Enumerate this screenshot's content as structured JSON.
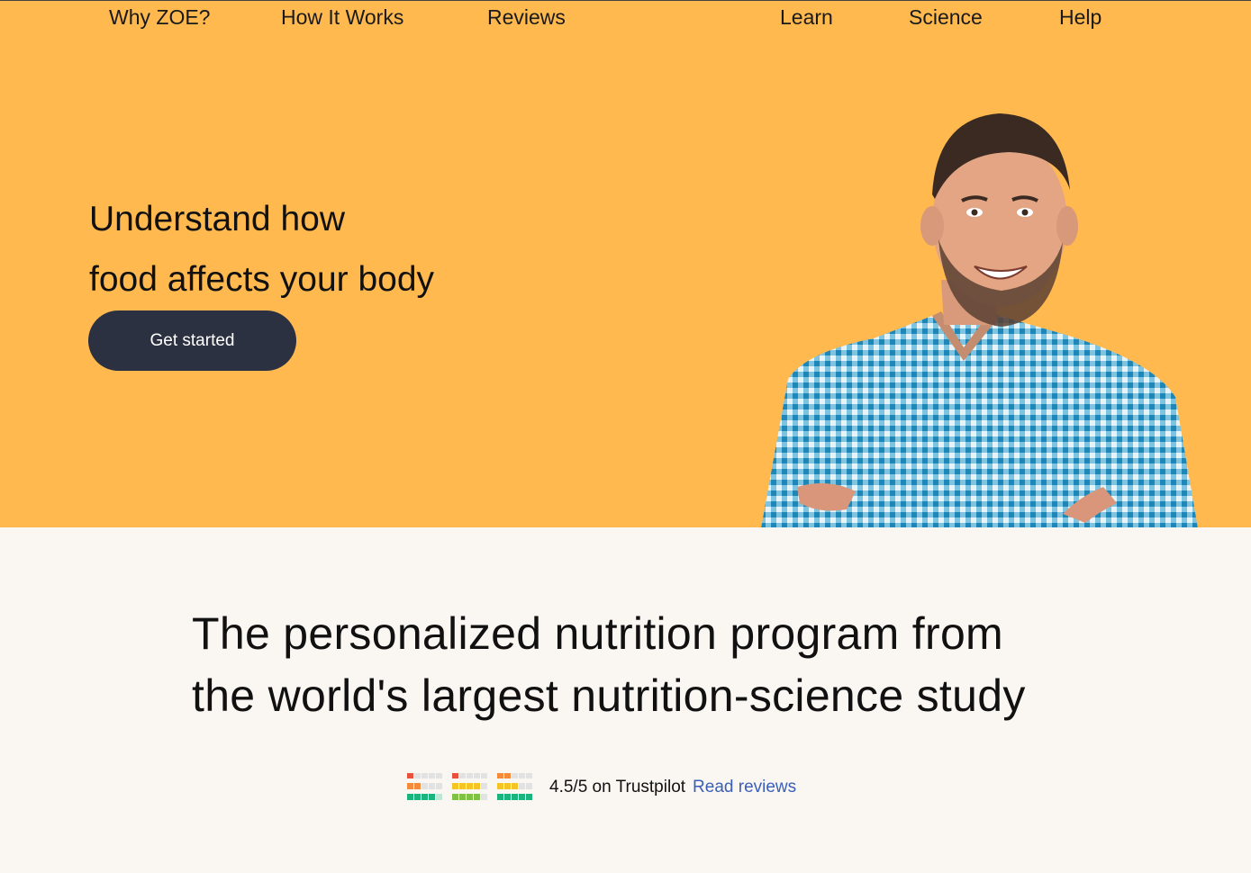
{
  "nav": {
    "items": [
      "Why ZOE?",
      "How It Works",
      "Reviews",
      "Learn",
      "Science",
      "Help"
    ]
  },
  "hero": {
    "headline_line1": "Understand how",
    "headline_line2": "food affects your body",
    "cta_label": "Get started",
    "background_color": "#ffb94f"
  },
  "tagline": {
    "line1": "The personalized nutrition program from",
    "line2": "the world's largest nutrition-science study"
  },
  "rating": {
    "score_text": "4.5/5 on Trustpilot",
    "link_label": "Read reviews",
    "link_color": "#3a5fb8"
  }
}
